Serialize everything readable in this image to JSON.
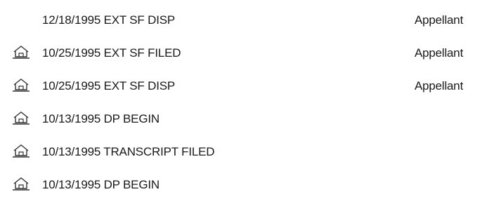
{
  "docket": {
    "rows": [
      {
        "entry": "12/18/1995 EXT SF DISP",
        "party": "Appellant",
        "icon": ""
      },
      {
        "entry": "10/25/1995 EXT SF FILED",
        "party": "Appellant",
        "icon": "house-icon"
      },
      {
        "entry": "10/25/1995 EXT SF DISP",
        "party": "Appellant",
        "icon": "house-icon"
      },
      {
        "entry": "10/13/1995 DP BEGIN",
        "party": "",
        "icon": "house-icon"
      },
      {
        "entry": "10/13/1995 TRANSCRIPT FILED",
        "party": "",
        "icon": "house-icon"
      },
      {
        "entry": "10/13/1995 DP BEGIN",
        "party": "",
        "icon": "house-icon"
      }
    ]
  }
}
